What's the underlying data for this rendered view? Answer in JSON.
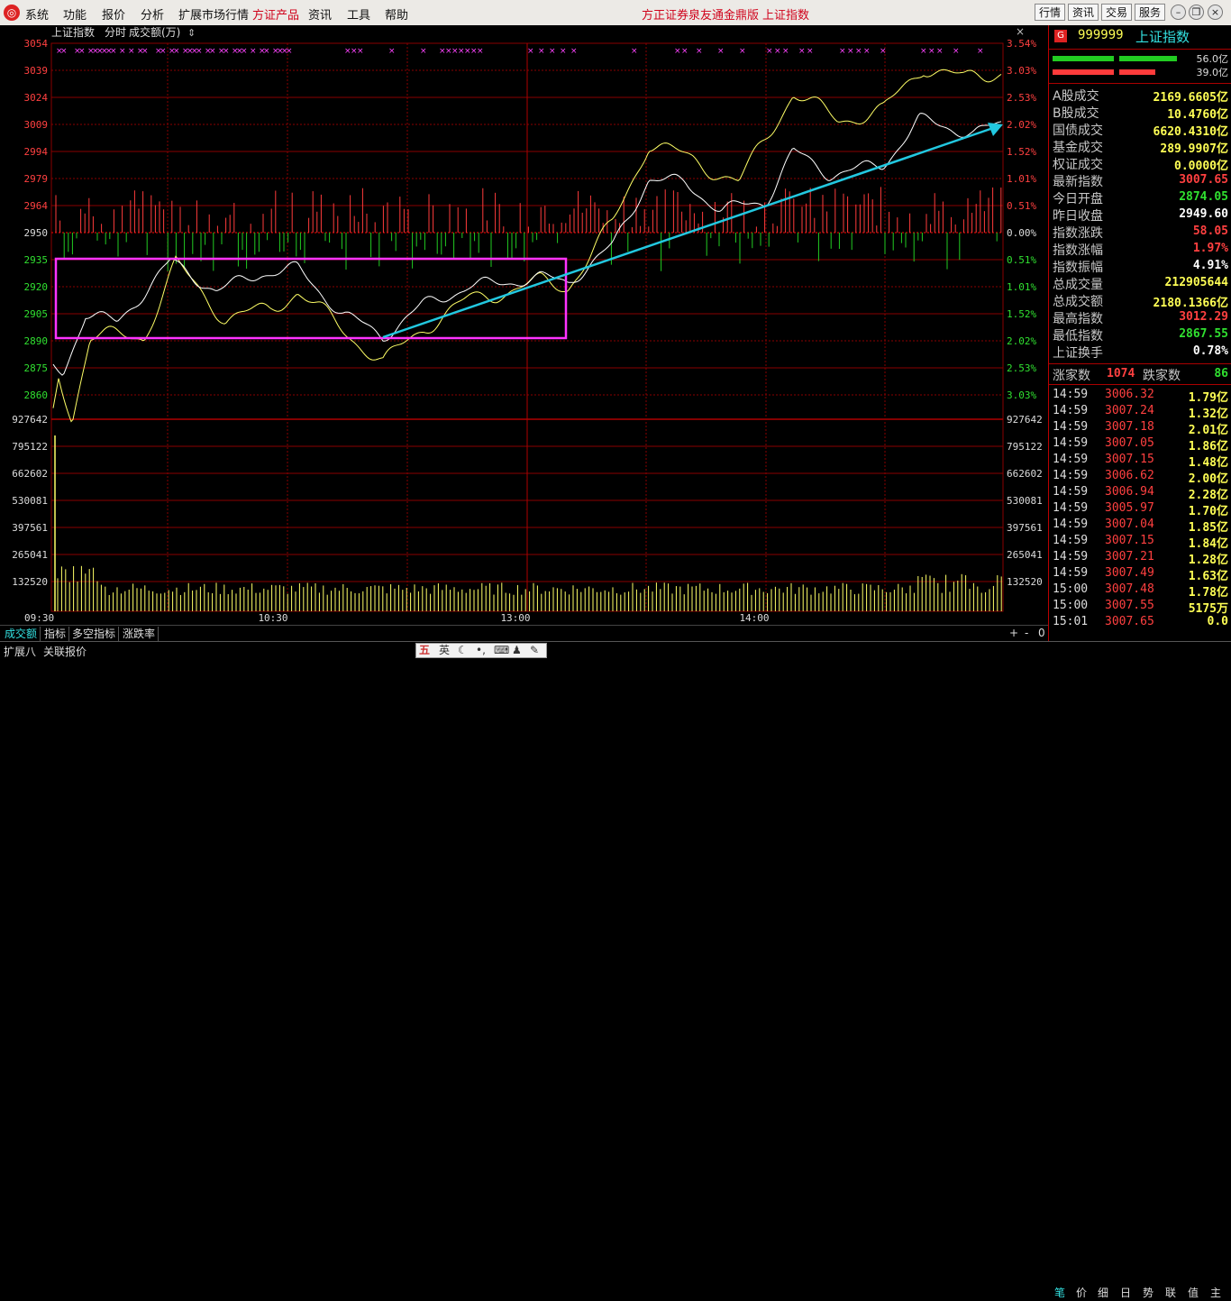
{
  "menubar": {
    "items": [
      "系统",
      "功能",
      "报价",
      "分析",
      "扩展市场行情",
      "方证产品",
      "资讯",
      "工具",
      "帮助"
    ],
    "title_left": "方正证券泉友通金鼎版",
    "title_right": "上证指数",
    "buttons": [
      "行情",
      "资讯",
      "交易",
      "服务"
    ],
    "window_controls": [
      "minimize-icon",
      "restore-icon",
      "close-icon"
    ]
  },
  "chart": {
    "header_name": "上证指数",
    "header_mode": "分时",
    "header_metric": "成交额(万)",
    "left_price_ticks": [
      "3054",
      "3039",
      "3024",
      "3009",
      "2994",
      "2979",
      "2964",
      "2950",
      "2935",
      "2920",
      "2905",
      "2890",
      "2875",
      "2860"
    ],
    "right_pct_ticks": [
      "3.54%",
      "3.03%",
      "2.53%",
      "2.02%",
      "1.52%",
      "1.01%",
      "0.51%",
      "0.00%",
      "0.51%",
      "1.01%",
      "1.52%",
      "2.02%",
      "2.53%",
      "3.03%"
    ],
    "volume_ticks": [
      "927642",
      "795122",
      "662602",
      "530081",
      "397561",
      "265041",
      "132520"
    ],
    "time_labels": [
      "09:30",
      "10:30",
      "13:00",
      "14:00"
    ],
    "colors": {
      "up": "#ff3b3b",
      "down": "#22cc22",
      "white_line": "#ffffff",
      "yellow_line": "#ffff66",
      "box": "#ff33ff",
      "arrow": "#22c8e0",
      "grid": "#8a0000"
    }
  },
  "panel": {
    "code": "999999",
    "name": "上证指数",
    "bar1_value": "56.0亿",
    "bar2_value": "39.0亿",
    "stats": [
      {
        "label": "A股成交",
        "value": "2169.6605亿",
        "color": "yel"
      },
      {
        "label": "B股成交",
        "value": "10.4760亿",
        "color": "yel"
      },
      {
        "label": "国债成交",
        "value": "6620.4310亿",
        "color": "yel"
      },
      {
        "label": "基金成交",
        "value": "289.9907亿",
        "color": "yel"
      },
      {
        "label": "权证成交",
        "value": "0.0000亿",
        "color": "yel"
      },
      {
        "label": "最新指数",
        "value": "3007.65",
        "color": "red"
      },
      {
        "label": "今日开盘",
        "value": "2874.05",
        "color": "grn"
      },
      {
        "label": "昨日收盘",
        "value": "2949.60",
        "color": "wht"
      },
      {
        "label": "指数涨跌",
        "value": "58.05",
        "color": "red"
      },
      {
        "label": "指数涨幅",
        "value": "1.97%",
        "color": "red"
      },
      {
        "label": "指数振幅",
        "value": "4.91%",
        "color": "wht"
      },
      {
        "label": "总成交量",
        "value": "212905644",
        "color": "yel"
      },
      {
        "label": "总成交额",
        "value": "2180.1366亿",
        "color": "yel"
      },
      {
        "label": "最高指数",
        "value": "3012.29",
        "color": "red"
      },
      {
        "label": "最低指数",
        "value": "2867.55",
        "color": "grn"
      },
      {
        "label": "上证换手",
        "value": "0.78%",
        "color": "wht"
      }
    ],
    "up_label": "涨家数",
    "up_count": "1074",
    "down_label": "跌家数",
    "down_count": "86",
    "ticks": [
      {
        "time": "14:59",
        "price": "3006.32",
        "amount": "1.79亿"
      },
      {
        "time": "14:59",
        "price": "3007.24",
        "amount": "1.32亿"
      },
      {
        "time": "14:59",
        "price": "3007.18",
        "amount": "2.01亿"
      },
      {
        "time": "14:59",
        "price": "3007.05",
        "amount": "1.86亿"
      },
      {
        "time": "14:59",
        "price": "3007.15",
        "amount": "1.48亿"
      },
      {
        "time": "14:59",
        "price": "3006.62",
        "amount": "2.00亿"
      },
      {
        "time": "14:59",
        "price": "3006.94",
        "amount": "2.28亿"
      },
      {
        "time": "14:59",
        "price": "3005.97",
        "amount": "1.70亿"
      },
      {
        "time": "14:59",
        "price": "3007.04",
        "amount": "1.85亿"
      },
      {
        "time": "14:59",
        "price": "3007.15",
        "amount": "1.84亿"
      },
      {
        "time": "14:59",
        "price": "3007.21",
        "amount": "1.28亿"
      },
      {
        "time": "14:59",
        "price": "3007.49",
        "amount": "1.63亿"
      },
      {
        "time": "15:00",
        "price": "3007.48",
        "amount": "1.78亿"
      },
      {
        "time": "15:00",
        "price": "3007.55",
        "amount": "5175万"
      },
      {
        "time": "15:01",
        "price": "3007.65",
        "amount": "0.0"
      }
    ]
  },
  "tabs": [
    "成交额",
    "指标",
    "多空指标",
    "涨跌率"
  ],
  "tab_controls": [
    "+",
    "-",
    "0"
  ],
  "status": {
    "left_items": [
      "扩展八",
      "关联报价"
    ],
    "ime_labels": [
      "英"
    ],
    "right_tabs": [
      "笔",
      "价",
      "细",
      "日",
      "势",
      "联",
      "值",
      "主"
    ]
  }
}
